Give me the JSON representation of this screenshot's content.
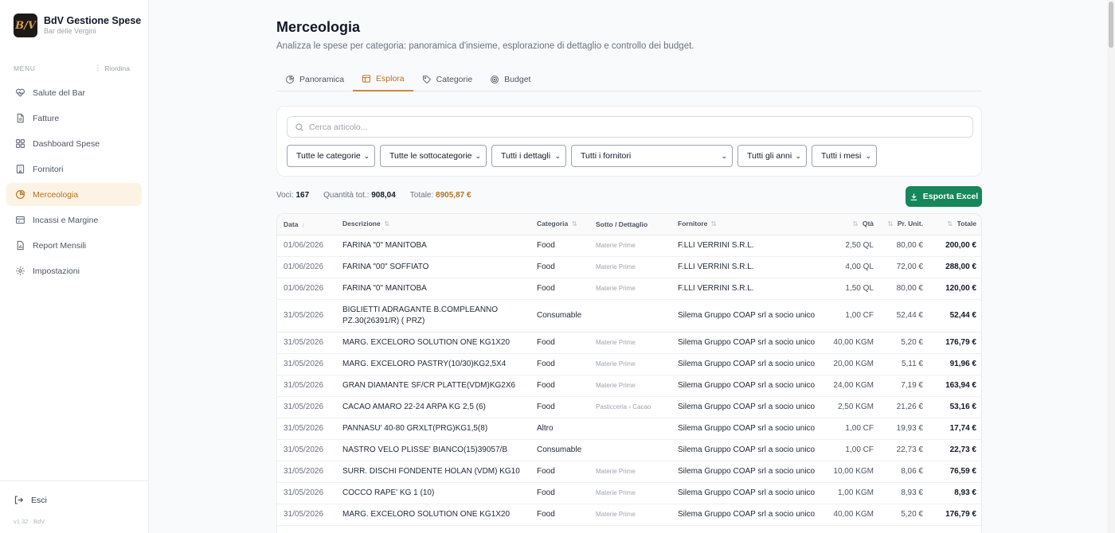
{
  "brand": {
    "title": "BdV Gestione Spese",
    "subtitle": "Bar delle Vergini",
    "logo_text": "B/V"
  },
  "sidebar": {
    "menu_label": "MENU",
    "reorder_label": "Riordina",
    "items": [
      {
        "label": "Salute del Bar",
        "icon": "heart-icon"
      },
      {
        "label": "Fatture",
        "icon": "document-icon"
      },
      {
        "label": "Dashboard Spese",
        "icon": "grid-icon"
      },
      {
        "label": "Fornitori",
        "icon": "building-icon"
      },
      {
        "label": "Merceologia",
        "icon": "pie-chart-icon",
        "active": true
      },
      {
        "label": "Incassi e Margine",
        "icon": "register-icon"
      },
      {
        "label": "Report Mensili",
        "icon": "report-icon"
      },
      {
        "label": "Impostazioni",
        "icon": "gear-icon"
      }
    ],
    "logout_label": "Esci",
    "version": "v1.32 · BdV"
  },
  "header": {
    "title": "Merceologia",
    "subtitle": "Analizza le spese per categoria: panoramica d'insieme, esplorazione di dettaglio e controllo dei budget."
  },
  "tabs": [
    {
      "label": "Panoramica",
      "icon": "pie-chart-icon"
    },
    {
      "label": "Esplora",
      "icon": "table-icon",
      "active": true
    },
    {
      "label": "Categorie",
      "icon": "tag-icon"
    },
    {
      "label": "Budget",
      "icon": "target-icon"
    }
  ],
  "filters": {
    "search_placeholder": "Cerca articolo...",
    "category": "Tutte le categorie",
    "subcategory": "Tutte le sottocategorie",
    "detail": "Tutti i dettagli",
    "supplier": "Tutti i fornitori",
    "year": "Tutti gli anni",
    "month": "Tutti i mesi"
  },
  "summary": {
    "voci_label": "Voci:",
    "voci_value": "167",
    "qty_label": "Quantità tot.:",
    "qty_value": "908,04",
    "total_label": "Totale:",
    "total_value": "8905,87 €"
  },
  "export_label": "Esporta Excel",
  "table": {
    "headers": {
      "date": "Data",
      "desc": "Descrizione",
      "cat": "Categoria",
      "sub": "Sotto / Dettaglio",
      "supplier": "Fornitore",
      "qty": "Qtà",
      "unit": "Pr. Unit.",
      "total": "Totale"
    },
    "rows": [
      {
        "date": "01/06/2026",
        "desc": "FARINA \"0\" MANITOBA",
        "cat": "Food",
        "sub": "Materie Prime",
        "supplier": "F.LLI VERRINI S.R.L.",
        "qty": "2,50 QL",
        "unit": "80,00 €",
        "total": "200,00 €"
      },
      {
        "date": "01/06/2026",
        "desc": "FARINA \"00\" SOFFIATO",
        "cat": "Food",
        "sub": "Materie Prime",
        "supplier": "F.LLI VERRINI S.R.L.",
        "qty": "4,00 QL",
        "unit": "72,00 €",
        "total": "288,00 €"
      },
      {
        "date": "01/06/2026",
        "desc": "FARINA \"0\" MANITOBA",
        "cat": "Food",
        "sub": "Materie Prime",
        "supplier": "F.LLI VERRINI S.R.L.",
        "qty": "1,50 QL",
        "unit": "80,00 €",
        "total": "120,00 €"
      },
      {
        "date": "31/05/2026",
        "desc": "BIGLIETTI ADRAGANTE B.COMPLEANNO PZ.30(26391/R) ( PRZ)",
        "cat": "Consumable",
        "sub": "",
        "supplier": "Silema Gruppo COAP srl a socio unico",
        "qty": "1,00 CF",
        "unit": "52,44 €",
        "total": "52,44 €",
        "tall": true
      },
      {
        "date": "31/05/2026",
        "desc": "MARG. EXCELORO SOLUTION ONE KG1X20",
        "cat": "Food",
        "sub": "Materie Prime",
        "supplier": "Silema Gruppo COAP srl a socio unico",
        "qty": "40,00 KGM",
        "unit": "5,20 €",
        "total": "176,79 €"
      },
      {
        "date": "31/05/2026",
        "desc": "MARG. EXCELORO PASTRY(10/30)KG2,5X4",
        "cat": "Food",
        "sub": "Materie Prime",
        "supplier": "Silema Gruppo COAP srl a socio unico",
        "qty": "20,00 KGM",
        "unit": "5,11 €",
        "total": "91,96 €"
      },
      {
        "date": "31/05/2026",
        "desc": "GRAN DIAMANTE SF/CR PLATTE(VDM)KG2X6",
        "cat": "Food",
        "sub": "Materie Prime",
        "supplier": "Silema Gruppo COAP srl a socio unico",
        "qty": "24,00 KGM",
        "unit": "7,19 €",
        "total": "163,94 €"
      },
      {
        "date": "31/05/2026",
        "desc": "CACAO AMARO 22-24 ARPA KG 2,5 (6)",
        "cat": "Food",
        "sub": "Pasticceria › Cacao",
        "supplier": "Silema Gruppo COAP srl a socio unico",
        "qty": "2,50 KGM",
        "unit": "21,26 €",
        "total": "53,16 €"
      },
      {
        "date": "31/05/2026",
        "desc": "PANNASU' 40-80 GRXLT(PRG)KG1,5(8)",
        "cat": "Altro",
        "sub": "",
        "supplier": "Silema Gruppo COAP srl a socio unico",
        "qty": "1,00 CF",
        "unit": "19,93 €",
        "total": "17,74 €"
      },
      {
        "date": "31/05/2026",
        "desc": "NASTRO VELO PLISSE' BIANCO(15)39057/B",
        "cat": "Consumable",
        "sub": "",
        "supplier": "Silema Gruppo COAP srl a socio unico",
        "qty": "1,00 CF",
        "unit": "22,73 €",
        "total": "22,73 €"
      },
      {
        "date": "31/05/2026",
        "desc": "SURR. DISCHI FONDENTE HOLAN (VDM) KG10",
        "cat": "Food",
        "sub": "Materie Prime",
        "supplier": "Silema Gruppo COAP srl a socio unico",
        "qty": "10,00 KGM",
        "unit": "8,06 €",
        "total": "76,59 €"
      },
      {
        "date": "31/05/2026",
        "desc": "COCCO RAPE' KG 1 (10)",
        "cat": "Food",
        "sub": "Materie Prime",
        "supplier": "Silema Gruppo COAP srl a socio unico",
        "qty": "1,00 KGM",
        "unit": "8,93 €",
        "total": "8,93 €"
      },
      {
        "date": "31/05/2026",
        "desc": "MARG. EXCELORO SOLUTION ONE KG1X20",
        "cat": "Food",
        "sub": "Materie Prime",
        "supplier": "Silema Gruppo COAP srl a socio unico",
        "qty": "40,00 KGM",
        "unit": "5,20 €",
        "total": "176,79 €"
      }
    ]
  }
}
